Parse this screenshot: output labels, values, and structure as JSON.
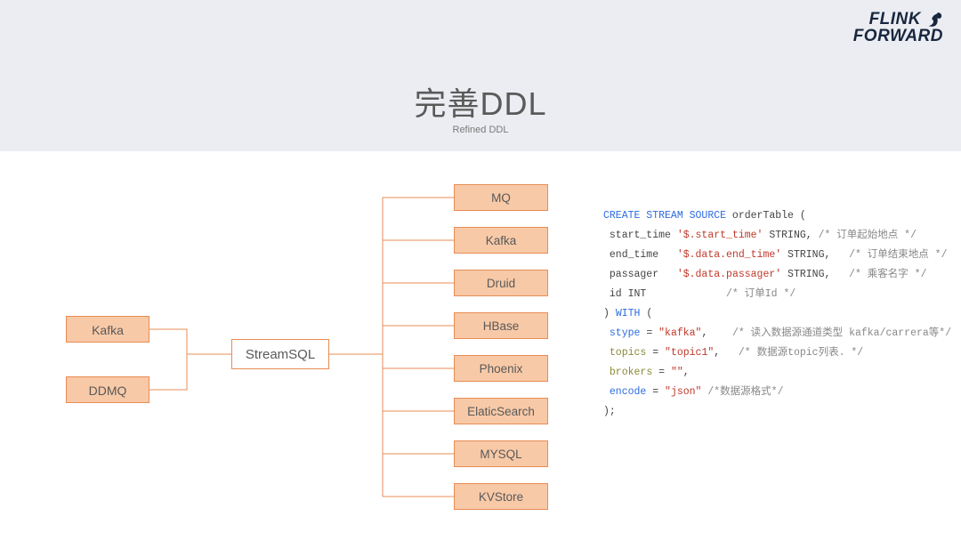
{
  "header": {
    "title": "完善DDL",
    "subtitle": "Refined DDL",
    "logo_line1": "FLINK",
    "logo_line2": "FORWARD"
  },
  "diagram": {
    "inputs": [
      "Kafka",
      "DDMQ"
    ],
    "center": "StreamSQL",
    "outputs": [
      "MQ",
      "Kafka",
      "Druid",
      "HBase",
      "Phoenix",
      "ElaticSearch",
      "MYSQL",
      "KVStore"
    ]
  },
  "code": {
    "kw_create": "CREATE STREAM SOURCE",
    "table_name": "orderTable",
    "open_paren": "(",
    "cols": [
      {
        "name": "start_time",
        "path": "'$.start_time'",
        "type": "STRING,",
        "pad1": " ",
        "pad2": "",
        "comment": "/* 订单起始地点 */"
      },
      {
        "name": "end_time",
        "path": "'$.data.end_time'",
        "type": "STRING,",
        "pad1": "   ",
        "pad2": "  ",
        "comment": "/* 订单结束地点 */"
      },
      {
        "name": "passager",
        "path": "'$.data.passager'",
        "type": "STRING,",
        "pad1": "   ",
        "pad2": "  ",
        "comment": "/* 乘客名字 */"
      }
    ],
    "id_line_name": "id",
    "id_line_type": "INT",
    "id_line_pad": "             ",
    "id_line_comment": "/* 订单Id */",
    "close_paren": ")",
    "kw_with": "WITH",
    "open_paren2": "(",
    "props": [
      {
        "key": "stype",
        "eq": " = ",
        "val": "\"kafka\"",
        "trail": ",    ",
        "comment": "/* 读入数据源通道类型 kafka/carrera等*/",
        "kw": true
      },
      {
        "key": "topics",
        "eq": " = ",
        "val": "\"topic1\"",
        "trail": ",   ",
        "comment": "/* 数据源topic列表. */",
        "kw": false
      },
      {
        "key": "brokers",
        "eq": " = ",
        "val": "\"\"",
        "trail": ",",
        "comment": "",
        "kw": false
      },
      {
        "key": "encode",
        "eq": " = ",
        "val": "\"json\"",
        "trail": " ",
        "comment": "/*数据源格式*/",
        "kw": true
      }
    ],
    "end": ");"
  }
}
